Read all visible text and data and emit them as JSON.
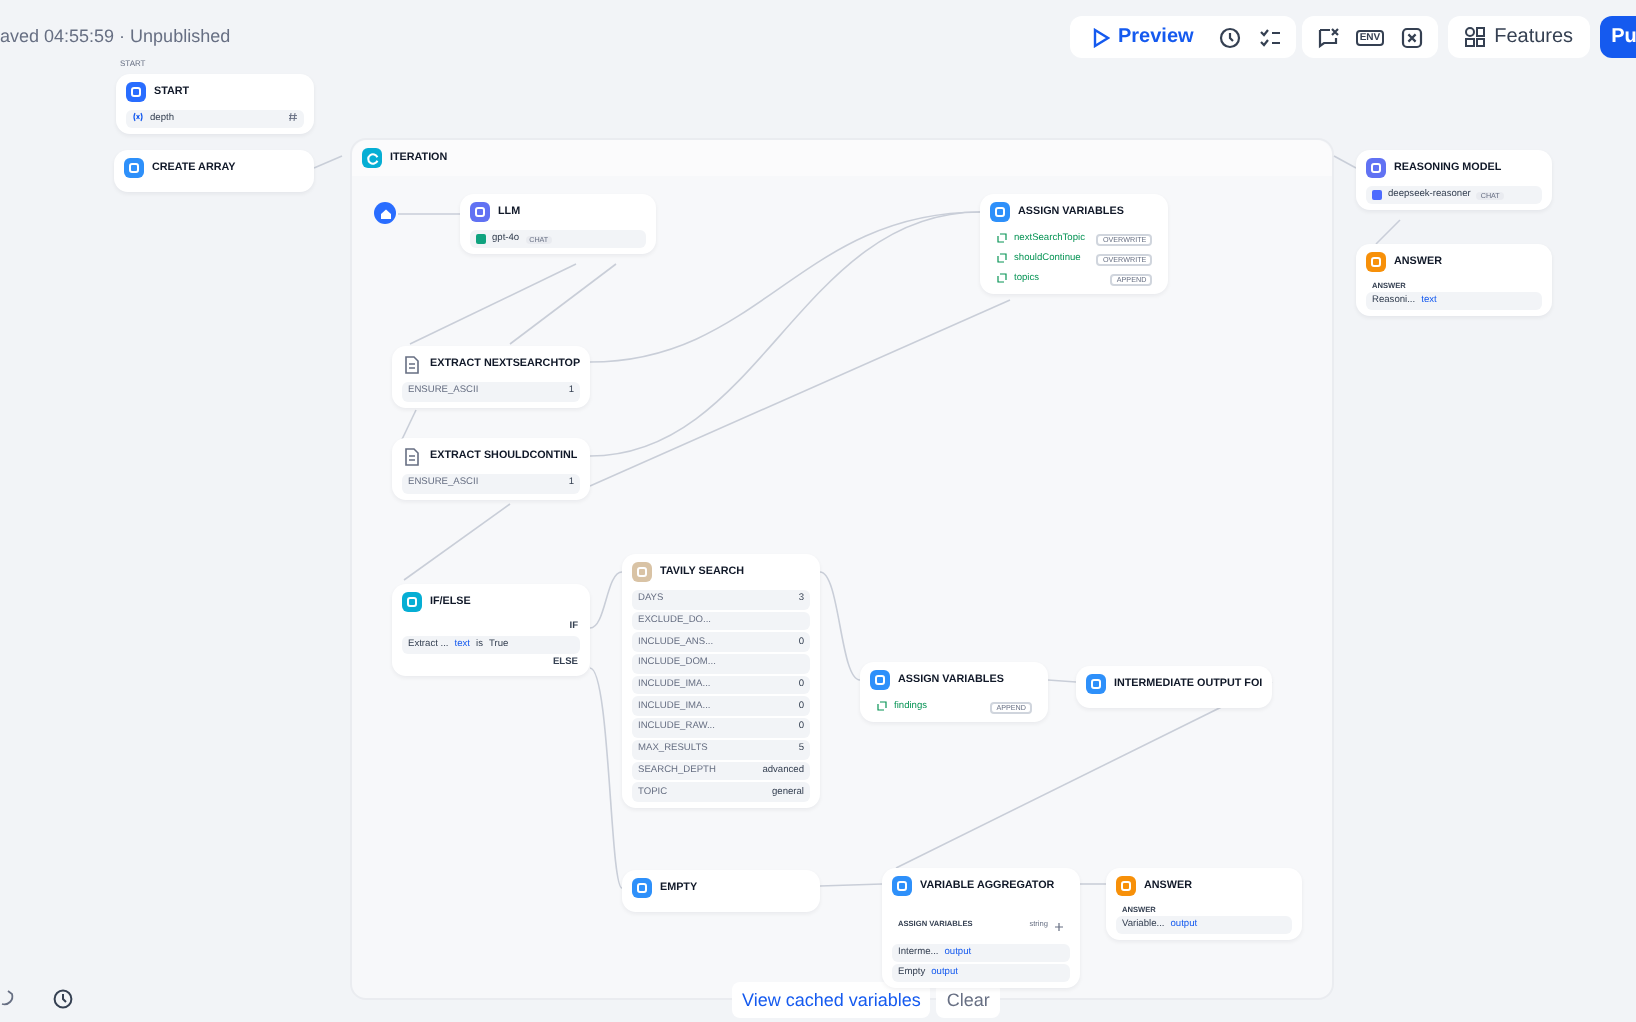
{
  "header": {
    "status": "aved 04:55:59 · Unpublished"
  },
  "toolbar": {
    "preview": "Preview",
    "env": "ENV",
    "features": "Features",
    "publish": "Pu"
  },
  "canvas": {
    "nodes": [
      {
        "kind": "start",
        "caption": "START",
        "title": "START",
        "rows": [
          {
            "kind": "variable",
            "name": "depth"
          }
        ]
      },
      {
        "kind": "code",
        "title": "CREATE ARRAY"
      },
      {
        "kind": "iteration",
        "title": "ITERATION"
      },
      {
        "kind": "iteration-start"
      },
      {
        "kind": "llm",
        "title": "LLM",
        "rows": [
          {
            "kind": "model",
            "name": "gpt-4o",
            "tags": [
              "CHAT"
            ]
          }
        ]
      },
      {
        "kind": "doc",
        "title": "EXTRACT NEXTSEARCHTOP",
        "rows": [
          {
            "kind": "param",
            "label": "ENSURE_ASCII",
            "value": "1"
          }
        ]
      },
      {
        "kind": "doc",
        "title": "EXTRACT SHOULDCONTINL",
        "rows": [
          {
            "kind": "param",
            "label": "ENSURE_ASCII",
            "value": "1"
          }
        ]
      },
      {
        "kind": "assign",
        "title": "ASSIGN VARIABLES",
        "rows": [
          {
            "kind": "assign",
            "name": "nextSearchTopic",
            "mode": "OVERWRITE"
          },
          {
            "kind": "assign",
            "name": "shouldContinue",
            "mode": "OVERWRITE"
          },
          {
            "kind": "assign",
            "name": "topics",
            "mode": "APPEND"
          }
        ]
      },
      {
        "kind": "ifelse",
        "title": "IF/ELSE",
        "rows": [
          {
            "kind": "branch",
            "label": "IF"
          },
          {
            "kind": "condition",
            "source": "Extract ...",
            "field": "text",
            "op": "is",
            "value": "True"
          },
          {
            "kind": "branch",
            "label": "ELSE"
          }
        ]
      },
      {
        "kind": "tavily",
        "title": "TAVILY SEARCH",
        "rows": [
          {
            "kind": "param",
            "label": "DAYS",
            "value": "3"
          },
          {
            "kind": "param",
            "label": "EXCLUDE_DO..."
          },
          {
            "kind": "param",
            "label": "INCLUDE_ANS...",
            "value": "0"
          },
          {
            "kind": "param",
            "label": "INCLUDE_DOM..."
          },
          {
            "kind": "param",
            "label": "INCLUDE_IMA...",
            "value": "0"
          },
          {
            "kind": "param",
            "label": "INCLUDE_IMA...",
            "value": "0"
          },
          {
            "kind": "param",
            "label": "INCLUDE_RAW...",
            "value": "0"
          },
          {
            "kind": "param",
            "label": "MAX_RESULTS",
            "value": "5"
          },
          {
            "kind": "param",
            "label": "SEARCH_DEPTH",
            "value": "advanced"
          },
          {
            "kind": "param",
            "label": "TOPIC",
            "value": "general"
          }
        ]
      },
      {
        "kind": "assign",
        "title": "ASSIGN VARIABLES",
        "rows": [
          {
            "kind": "assign",
            "name": "findings",
            "mode": "APPEND"
          }
        ]
      },
      {
        "kind": "output",
        "title": "INTERMEDIATE OUTPUT FOI"
      },
      {
        "kind": "output",
        "title": "EMPTY"
      },
      {
        "kind": "aggregator",
        "title": "VARIABLE AGGREGATOR",
        "rows": [
          {
            "kind": "section",
            "label": "ASSIGN VARIABLES",
            "note": "string"
          },
          {
            "kind": "ref",
            "source": "Interme...",
            "field": "output"
          },
          {
            "kind": "ref",
            "source": "Empty",
            "field": "output"
          }
        ]
      },
      {
        "kind": "answer",
        "title": "ANSWER",
        "rows": [
          {
            "kind": "section",
            "label": "ANSWER"
          },
          {
            "kind": "ref",
            "source": "Variable...",
            "field": "output"
          }
        ]
      },
      {
        "kind": "llm",
        "title": "REASONING MODEL",
        "rows": [
          {
            "kind": "model",
            "name": "deepseek-reasoner",
            "tags": [
              "CHAT"
            ]
          }
        ]
      },
      {
        "kind": "answer",
        "title": "ANSWER",
        "rows": [
          {
            "kind": "section",
            "label": "ANSWER"
          },
          {
            "kind": "ref",
            "source": "Reasoni...",
            "field": "text"
          }
        ]
      }
    ]
  },
  "footer": {
    "view_cached": "View cached variables",
    "clear": "Clear"
  }
}
